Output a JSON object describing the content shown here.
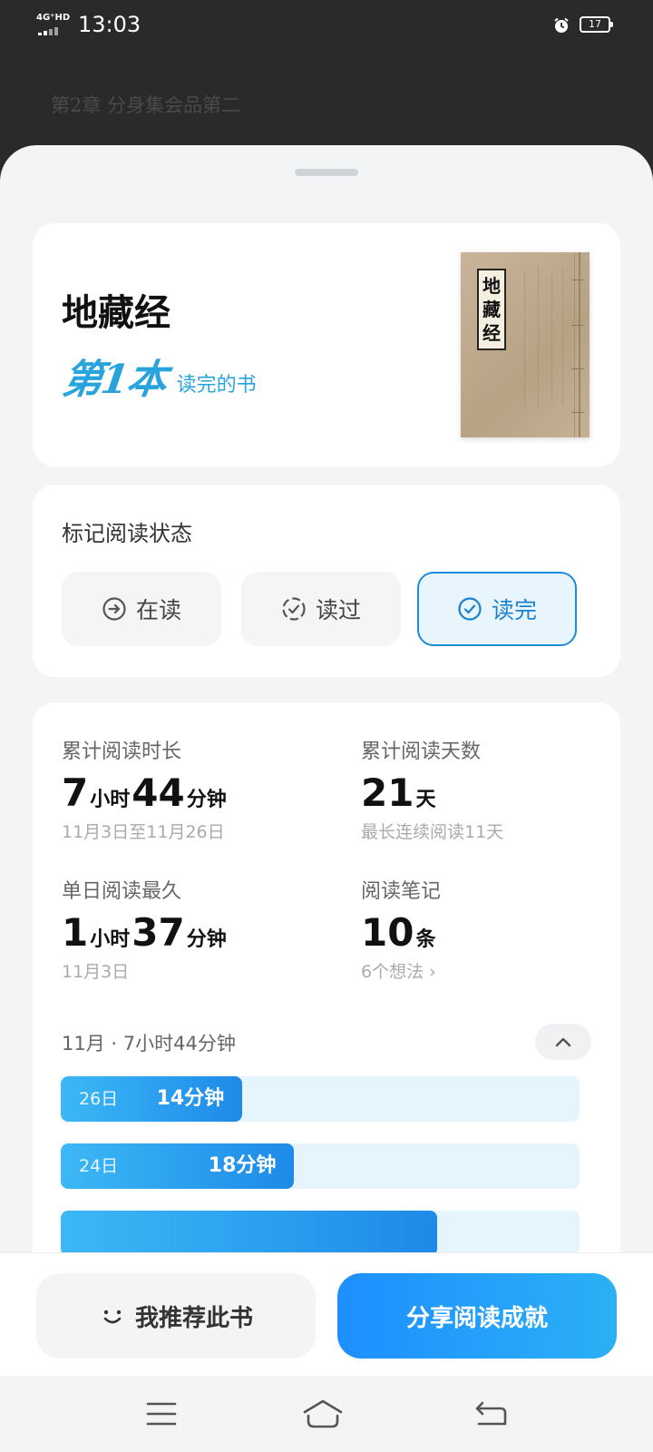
{
  "status_bar": {
    "network": "4G⁺HD",
    "time": "13:03",
    "battery": "17"
  },
  "background": {
    "chapter": "第2章 分身集会品第二"
  },
  "book": {
    "title": "地藏经",
    "rank_big": "第1本",
    "rank_small": "读完的书",
    "cover_title": "地藏经"
  },
  "reading_status": {
    "title": "标记阅读状态",
    "options": [
      {
        "label": "在读",
        "icon": "arrow-circle-icon",
        "active": false
      },
      {
        "label": "读过",
        "icon": "dashed-check-circle-icon",
        "active": false
      },
      {
        "label": "读完",
        "icon": "check-circle-icon",
        "active": true
      }
    ]
  },
  "stats": {
    "total_time": {
      "label": "累计阅读时长",
      "h": "7",
      "h_unit": "小时",
      "m": "44",
      "m_unit": "分钟",
      "sub": "11月3日至11月26日"
    },
    "total_days": {
      "label": "累计阅读天数",
      "num": "21",
      "unit": "天",
      "sub": "最长连续阅读11天"
    },
    "longest_day": {
      "label": "单日阅读最久",
      "h": "1",
      "h_unit": "小时",
      "m": "37",
      "m_unit": "分钟",
      "sub": "11月3日"
    },
    "notes": {
      "label": "阅读笔记",
      "num": "10",
      "unit": "条",
      "sub": "6个想法"
    }
  },
  "monthly": {
    "month": "11月",
    "total": "7小时44分钟",
    "days": [
      {
        "day": "26日",
        "minutes": "14分钟",
        "value": 14
      },
      {
        "day": "24日",
        "minutes": "18分钟",
        "value": 18
      },
      {
        "day": "",
        "minutes": "",
        "value": 29
      }
    ]
  },
  "actions": {
    "recommend": "我推荐此书",
    "share": "分享阅读成就"
  },
  "colors": {
    "accent": "#1f8ad6",
    "bar_fill": "#2a9ff0",
    "bar_track": "#e6f5fd",
    "share_button": "#1d8fff"
  }
}
